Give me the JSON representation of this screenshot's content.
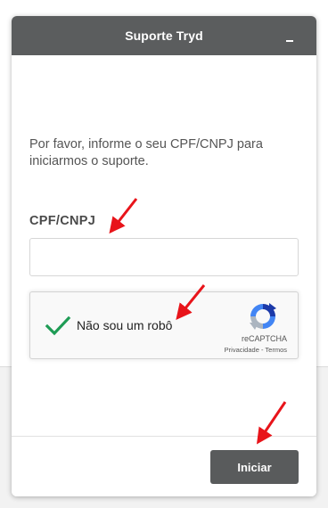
{
  "widget": {
    "title": "Suporte Tryd",
    "minimize_symbol": "–",
    "intro": "Por favor, informe o seu CPF/CNPJ para iniciarmos o suporte.",
    "cpf_label": "CPF/CNPJ",
    "cpf_value": "",
    "recaptcha": {
      "label": "Não sou um robô",
      "brand": "reCAPTCHA",
      "privacy": "Privacidade",
      "separator": " - ",
      "terms": "Termos",
      "checked": true,
      "check_color": "#1e9c55"
    },
    "start_button": "Iniciar"
  },
  "colors": {
    "header_bg": "#5b5d5e",
    "button_bg": "#595b5c",
    "annotation": "#e8141a"
  }
}
